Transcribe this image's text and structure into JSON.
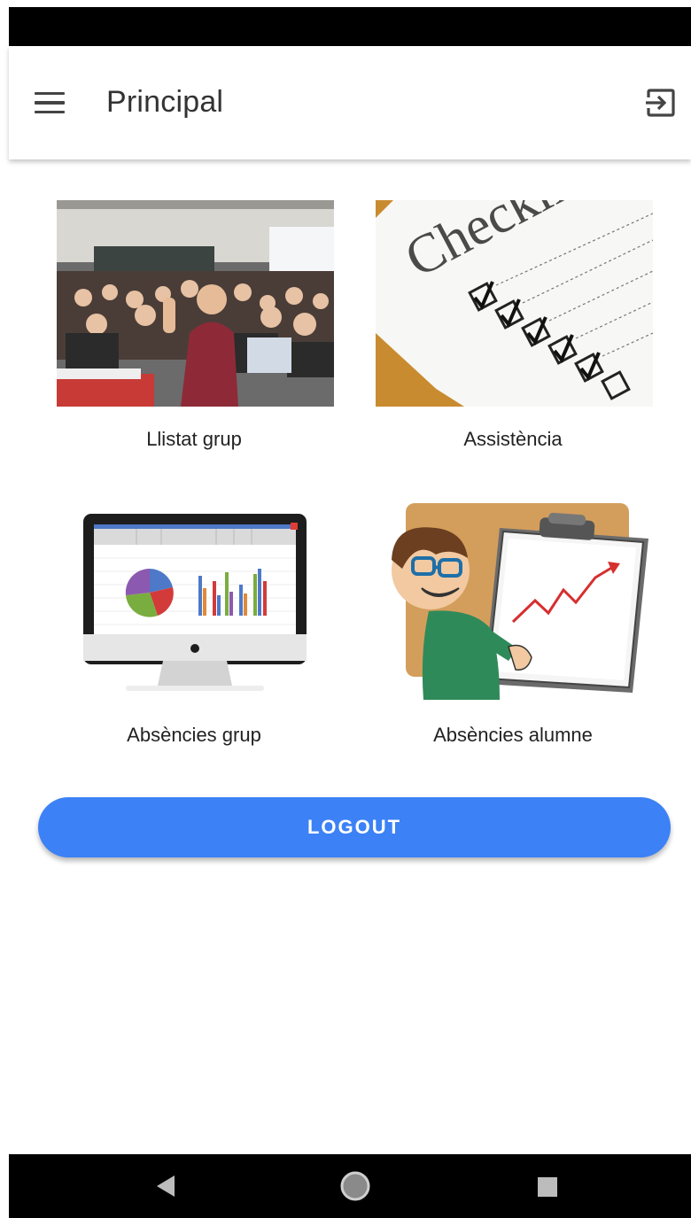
{
  "app_bar": {
    "title": "Principal",
    "menu_icon": "menu-icon",
    "exit_icon": "logout-icon"
  },
  "tiles": [
    {
      "label": "Llistat grup",
      "image": "classroom-photo"
    },
    {
      "label": "Assistència",
      "image": "checklist-photo"
    },
    {
      "label": "Absències grup",
      "image": "monitor-charts-illustration"
    },
    {
      "label": "Absències alumne",
      "image": "presenter-clipboard-illustration"
    }
  ],
  "logout_button": {
    "label": "LOGOUT"
  },
  "navigation": {
    "back_icon": "back-triangle-icon",
    "home_icon": "home-circle-icon",
    "recents_icon": "recents-square-icon"
  },
  "colors": {
    "accent": "#3c81f5",
    "status_bar": "#000000",
    "nav_bar": "#000000"
  }
}
